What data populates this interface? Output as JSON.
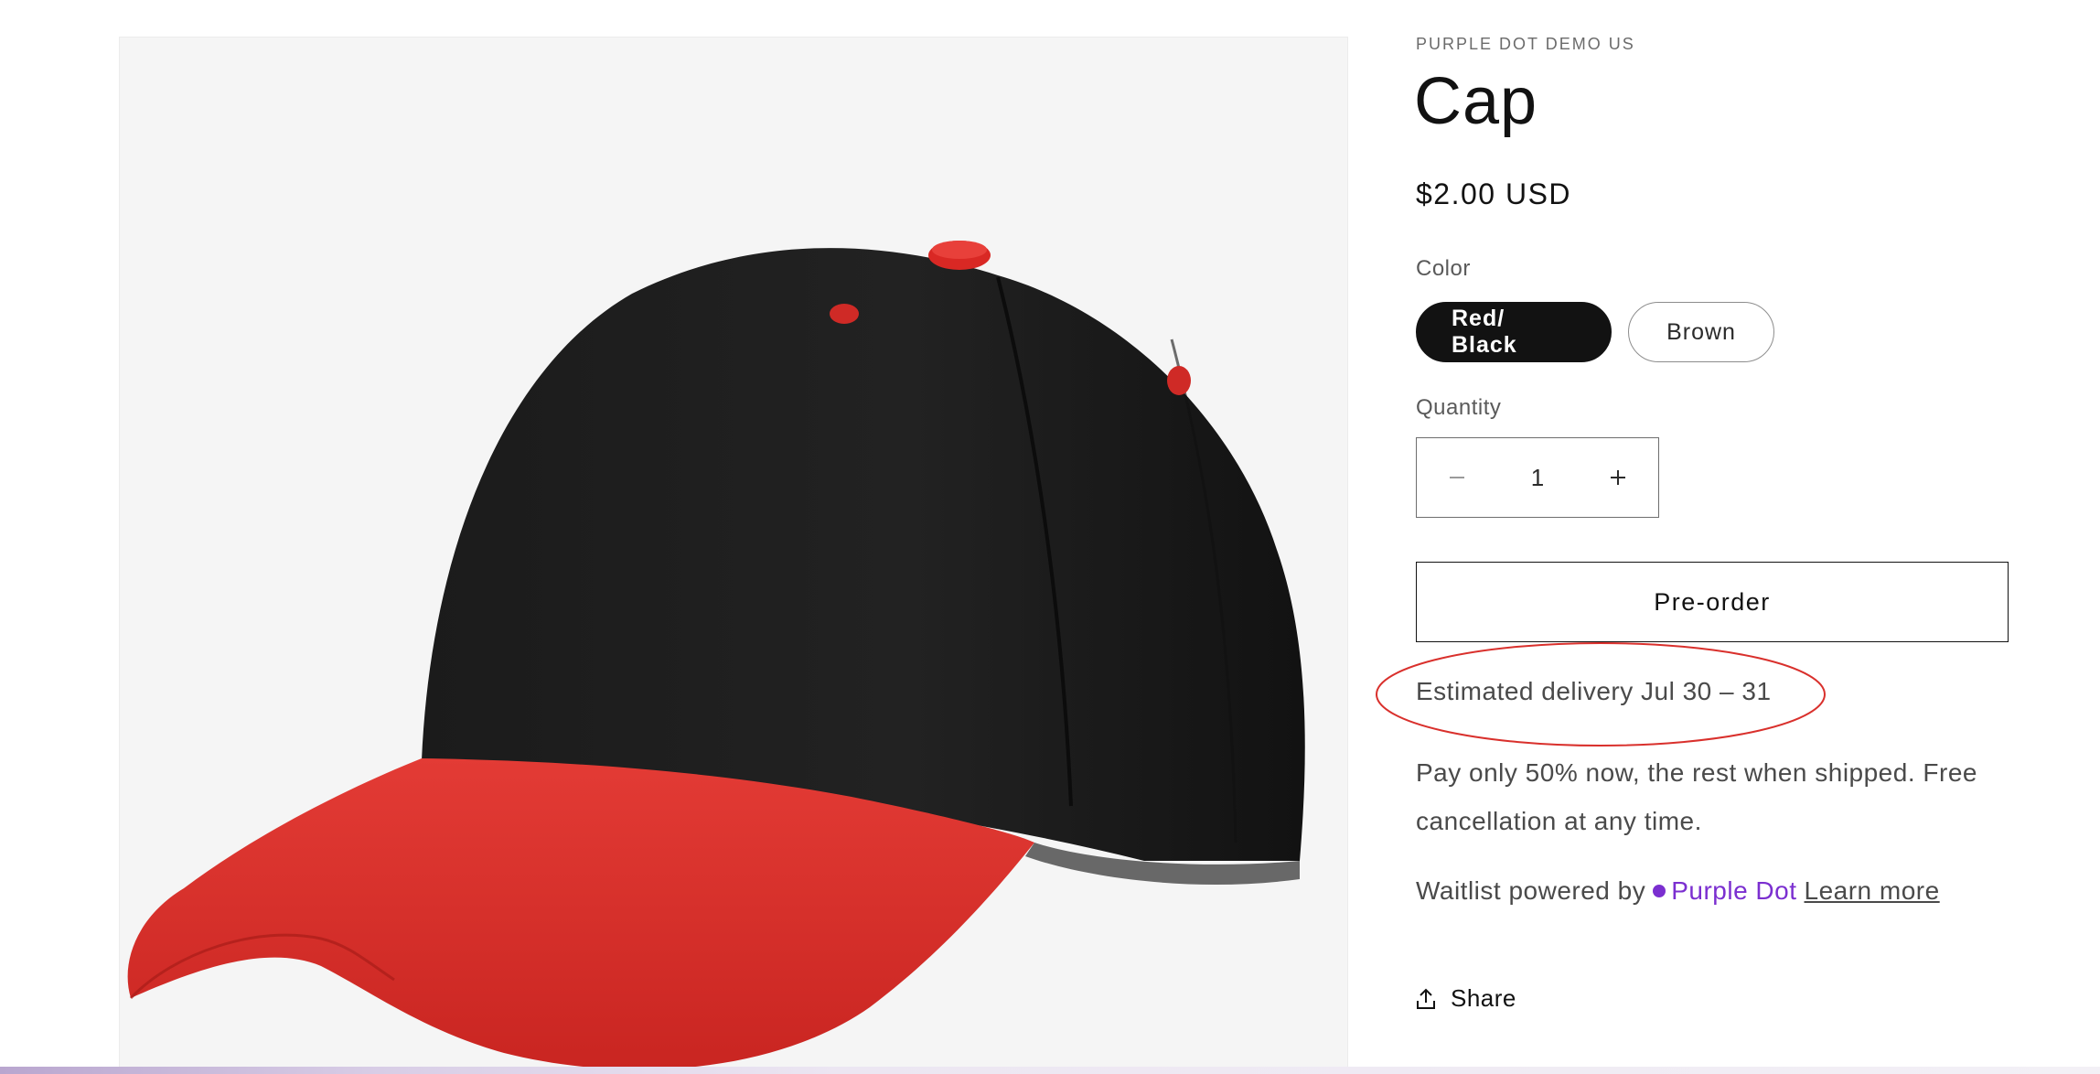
{
  "product": {
    "vendor": "PURPLE DOT DEMO US",
    "title": "Cap",
    "price": "$2.00 USD"
  },
  "color": {
    "label": "Color",
    "options": [
      "Red/ Black",
      "Brown"
    ],
    "selected": "Red/ Black"
  },
  "quantity": {
    "label": "Quantity",
    "value": "1"
  },
  "actions": {
    "preorder_label": "Pre-order",
    "share_label": "Share"
  },
  "delivery": {
    "text": "Estimated delivery Jul 30 – 31"
  },
  "deposit": {
    "text": "Pay only 50% now, the rest when shipped. Free cancellation at any time."
  },
  "waitlist": {
    "prefix": "Waitlist powered by",
    "brand": "Purple Dot",
    "link": "Learn more"
  },
  "colors": {
    "brand_purple": "#7b2fd0",
    "annotation_red": "#d9302c",
    "selected_pill": "#121212"
  },
  "icons": {
    "minus": "minus-icon",
    "plus": "plus-icon",
    "share": "share-icon"
  }
}
